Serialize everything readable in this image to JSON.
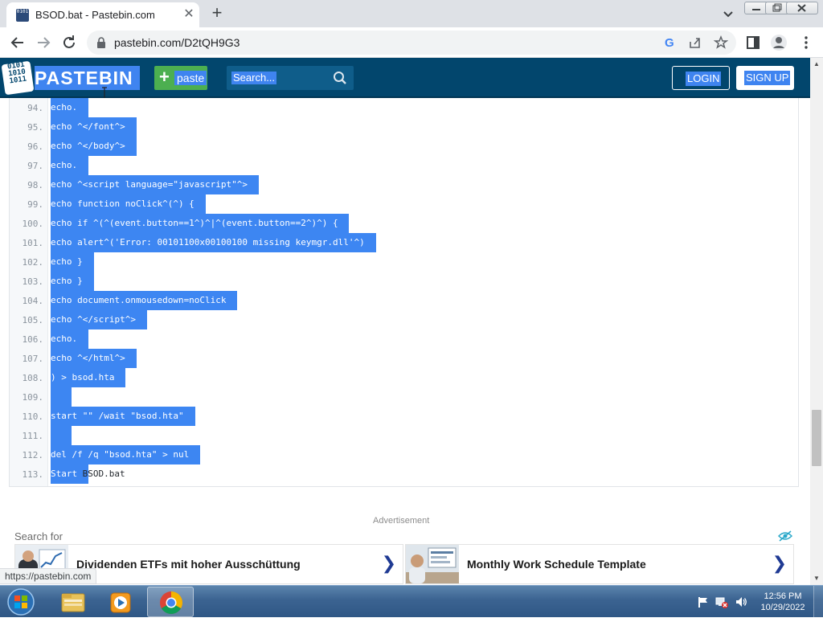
{
  "browser": {
    "tab_title": "BSOD.bat - Pastebin.com",
    "favicon_text": "0101",
    "url": "pastebin.com/D2tQH9G3"
  },
  "pastebin": {
    "logo_icon_lines": [
      "0101",
      "1010",
      "1011"
    ],
    "logo_text": "PASTEBIN",
    "paste_button": "paste",
    "search_placeholder": "Search...",
    "login": "LOGIN",
    "signup": "SIGN UP",
    "accent": "#3f84f0",
    "header_bg": "#02466d"
  },
  "code": {
    "selection_color": "#3d86f2",
    "lines": [
      {
        "n": "94.",
        "text": "echo."
      },
      {
        "n": "95.",
        "text": "echo ^</font^>"
      },
      {
        "n": "96.",
        "text": "echo ^</body^>"
      },
      {
        "n": "97.",
        "text": "echo."
      },
      {
        "n": "98.",
        "text": "echo ^<script language=\"javascript\"^>"
      },
      {
        "n": "99.",
        "text": "echo function noClick^(^) {"
      },
      {
        "n": "100.",
        "text": "echo if ^(^(event.button==1^)^|^(event.button==2^)^) {"
      },
      {
        "n": "101.",
        "text": "echo alert^('Error: 00101100x00100100 missing keymgr.dll'^)"
      },
      {
        "n": "102.",
        "text": "echo }"
      },
      {
        "n": "103.",
        "text": "echo }"
      },
      {
        "n": "104.",
        "text": "echo document.onmousedown=noClick"
      },
      {
        "n": "105.",
        "text": "echo ^</script^>"
      },
      {
        "n": "106.",
        "text": "echo."
      },
      {
        "n": "107.",
        "text": "echo ^</html^>"
      },
      {
        "n": "108.",
        "text": ") > bsod.hta"
      },
      {
        "n": "109.",
        "text": ""
      },
      {
        "n": "110.",
        "text": "start \"\" /wait \"bsod.hta\""
      },
      {
        "n": "111.",
        "text": ""
      },
      {
        "n": "112.",
        "text": "del /f /q \"bsod.hta\" > nul"
      },
      {
        "n": "113.",
        "text": "Start",
        "tail": " BSOD.bat"
      }
    ]
  },
  "ads": {
    "label": "Advertisement",
    "search_for": "Search for",
    "items": [
      {
        "title": "Dividenden ETFs mit hoher Ausschüttung"
      },
      {
        "title": "Monthly Work Schedule Template"
      }
    ]
  },
  "status_bar": {
    "hover_url": "https://pastebin.com"
  },
  "taskbar": {
    "time": "12:56 PM",
    "date": "10/29/2022",
    "apps": [
      "explorer-icon",
      "media-player-icon",
      "chrome-icon"
    ]
  }
}
